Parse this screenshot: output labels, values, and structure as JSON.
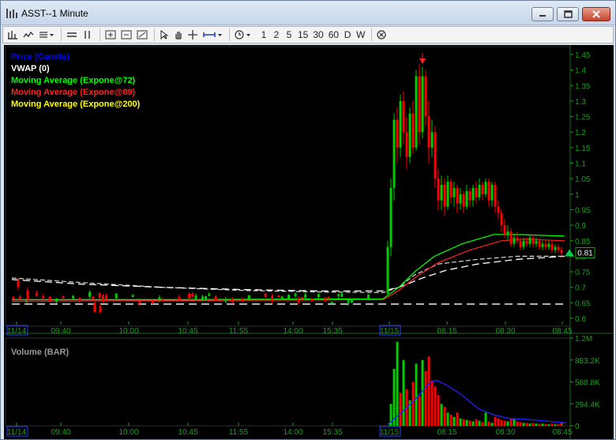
{
  "window": {
    "title": "ASST--1 Minute"
  },
  "toolbar": {
    "intervals": [
      "1",
      "2",
      "5",
      "15",
      "30",
      "60",
      "D",
      "W"
    ]
  },
  "legend": {
    "price": "Price (Candle)",
    "vwap": "VWAP (0)",
    "ema72": "Moving Average (Expone@72)",
    "ema89": "Moving Average (Expone@89)",
    "ema200": "Moving Average (Expone@200)"
  },
  "volume_panel": {
    "title": "Volume (BAR)",
    "axis_labels": [
      "1.2M",
      "883.2K",
      "588.8K",
      "294.4K",
      "0"
    ]
  },
  "time_axis": {
    "labels": [
      "11/14",
      "09:40",
      "10:00",
      "10:45",
      "11:55",
      "14:00",
      "15:35",
      "11/15",
      "08:15",
      "08:30",
      "08:45"
    ],
    "date_labels": [
      "11/14",
      "11/15"
    ]
  },
  "colors": {
    "up": "#00cc00",
    "down": "#ff0000",
    "vwap": "#ffffff",
    "ema72": "#00ff00",
    "ema89": "#ff2020",
    "ema200": "#ffffff",
    "volume_avg": "#2020ff",
    "axis_text": "#18a018",
    "last_price_marker": "#00cc44"
  },
  "chart_data": {
    "type": "candlestick",
    "price_axis": {
      "labels": [
        "1.45",
        "1.4",
        "1.35",
        "1.3",
        "1.25",
        "1.2",
        "1.15",
        "1.1",
        "1.05",
        "1",
        "0.95",
        "0.9",
        "0.85",
        "0.8",
        "0.75",
        "0.7",
        "0.65",
        "0.6"
      ],
      "range": [
        0.6,
        1.45
      ]
    },
    "last_price": "0.81",
    "volume_axis": {
      "range": [
        0,
        1200000
      ]
    }
  }
}
